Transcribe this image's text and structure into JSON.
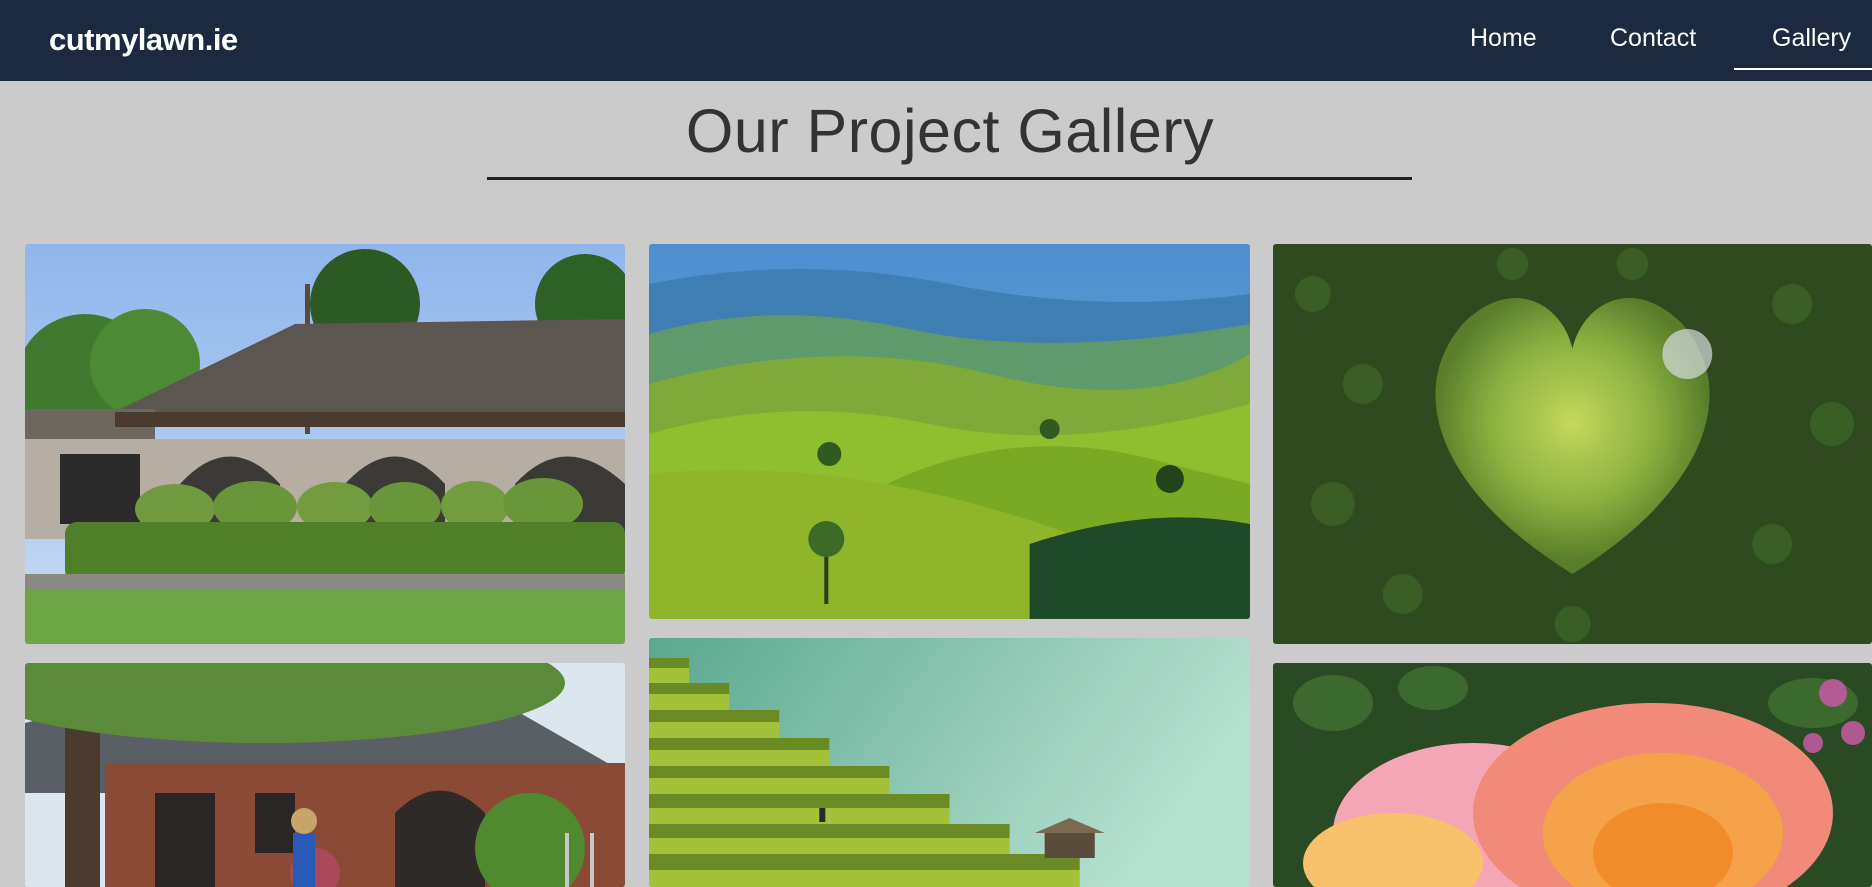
{
  "header": {
    "brand": "cutmylawn.ie",
    "nav": {
      "home": "Home",
      "contact": "Contact",
      "gallery": "Gallery"
    },
    "active": "Gallery",
    "background_color": "#1b2a40"
  },
  "main": {
    "title": "Our Project Gallery",
    "gallery": [
      {
        "subject": "house with trimmed hedges"
      },
      {
        "subject": "green rolling tea hills"
      },
      {
        "subject": "heart-shaped hedge opening"
      },
      {
        "subject": "brick house with gardener"
      },
      {
        "subject": "terraced rice fields"
      },
      {
        "subject": "orange and pink roses"
      }
    ]
  },
  "colors": {
    "page_background": "#cbcbcb",
    "title_text": "#333333"
  }
}
